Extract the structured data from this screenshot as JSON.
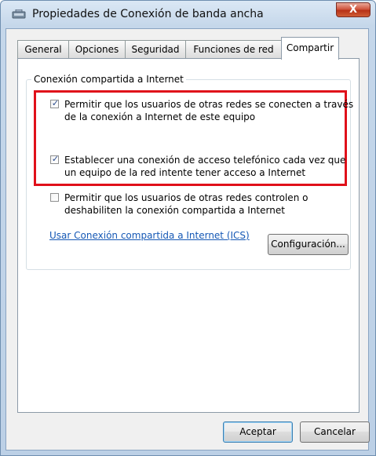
{
  "window": {
    "title": "Propiedades de Conexión de banda ancha",
    "close_label": "X"
  },
  "tabs": [
    {
      "label": "General",
      "active": false
    },
    {
      "label": "Opciones",
      "active": false
    },
    {
      "label": "Seguridad",
      "active": false
    },
    {
      "label": "Funciones de red",
      "active": false
    },
    {
      "label": "Compartir",
      "active": true
    }
  ],
  "group": {
    "title": "Conexión compartida a Internet"
  },
  "options": [
    {
      "label": "Permitir que los usuarios de otras redes se conecten a través de la conexión a Internet de este equipo",
      "checked": true
    },
    {
      "label": "Establecer una conexión de acceso telefónico cada vez que un equipo de la red intente tener acceso a Internet",
      "checked": true
    },
    {
      "label": "Permitir que los usuarios de otras redes controlen o deshabiliten la conexión compartida a Internet",
      "checked": false
    }
  ],
  "link": {
    "text": "Usar Conexión compartida a Internet (ICS)"
  },
  "buttons": {
    "config": "Configuración...",
    "ok": "Aceptar",
    "cancel": "Cancelar"
  },
  "colors": {
    "highlight": "#e0101a",
    "link": "#1558b5"
  },
  "icons": {
    "title": "network-connection-icon",
    "close": "close-icon",
    "check": "checkmark-icon"
  }
}
